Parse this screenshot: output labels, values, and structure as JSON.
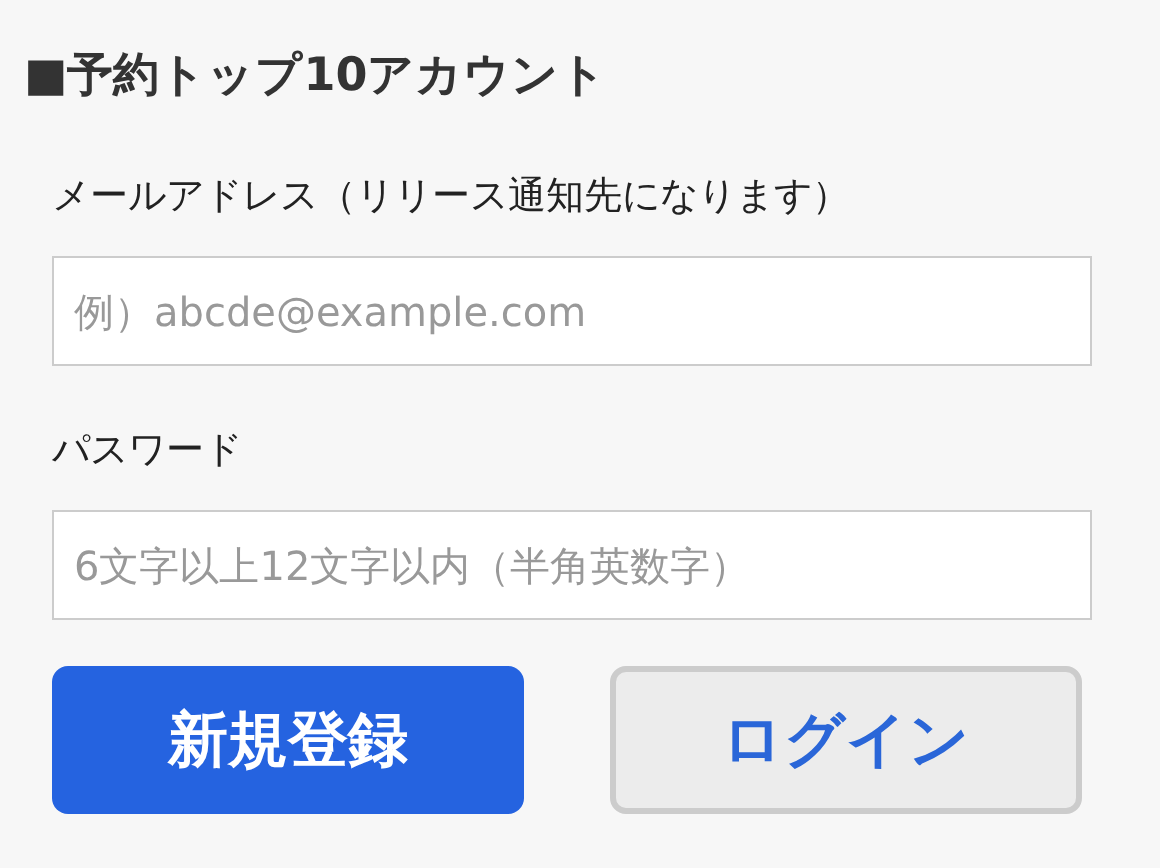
{
  "heading": "■予約トップ10アカウント",
  "fields": [
    {
      "label": "メールアドレス（リリース通知先になります）",
      "placeholder": "例）abcde@example.com"
    },
    {
      "label": "パスワード",
      "placeholder": "6文字以上12文字以内（半角英数字）"
    }
  ],
  "buttons": [
    {
      "label": "新規登録",
      "kind": "primary"
    },
    {
      "label": "ログイン",
      "kind": "secondary"
    }
  ]
}
